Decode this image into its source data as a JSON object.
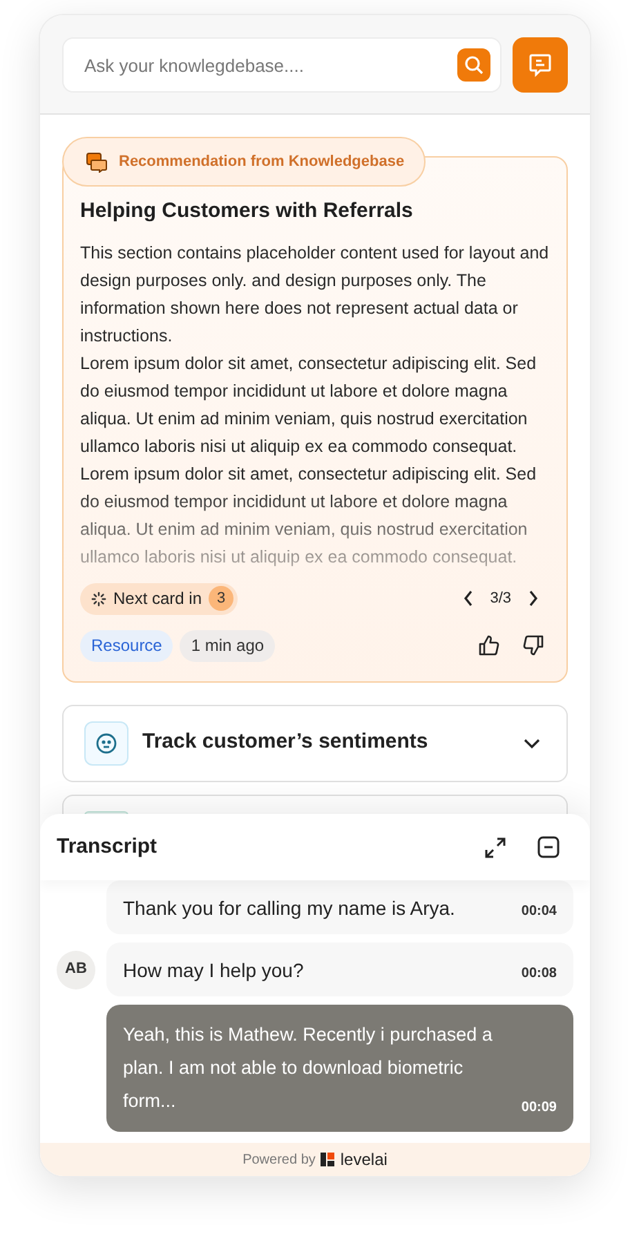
{
  "search": {
    "placeholder": "Ask your knowlegdebase...."
  },
  "recommendation": {
    "badge": "Recommendation from Knowledgebase",
    "title": "Helping Customers with Referrals",
    "paragraphs": [
      "This section contains placeholder content used for layout and design purposes only. and design purposes only. The information shown here does not represent actual data or instructions.",
      "Lorem ipsum dolor sit amet, consectetur adipiscing elit. Sed do eiusmod tempor incididunt ut labore et dolore magna aliqua. Ut enim ad minim veniam, quis nostrud exercitation ullamco laboris nisi ut aliquip ex ea commodo consequat. Lorem ipsum dolor sit amet, consectetur adipiscing elit. Sed do eiusmod tempor incididunt ut labore et dolore magna aliqua. Ut enim ad minim veniam, quis nostrud exercitation ullamco laboris nisi ut aliquip ex ea commodo consequat."
    ],
    "next_card_label": "Next card in",
    "next_card_count": "3",
    "pager": "3/3",
    "tags": [
      {
        "label": "Resource",
        "kind": "type"
      },
      {
        "label": "1 min ago",
        "kind": "time"
      }
    ]
  },
  "sections": [
    {
      "title": "Track customer’s sentiments",
      "expanded": false
    }
  ],
  "transcript": {
    "title": "Transcript",
    "messages": [
      {
        "text": "Thank you for calling my name is Arya.",
        "time": "00:04",
        "kind": "agent"
      },
      {
        "text": "How may I help you?",
        "time": "00:08",
        "kind": "agent",
        "avatar": "AB"
      },
      {
        "text": "Yeah, this is Mathew. Recently i purchased a plan. I am not able to download biometric form...",
        "time": "00:09",
        "kind": "customer"
      }
    ]
  },
  "footer": {
    "powered_by": "Powered by",
    "brand": "levelai"
  }
}
